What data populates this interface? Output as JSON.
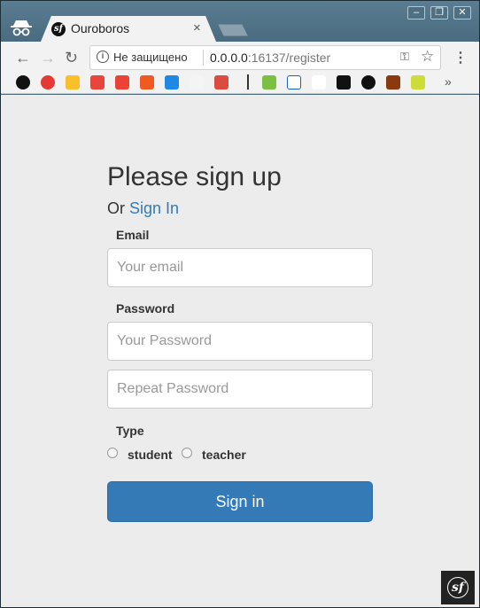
{
  "browser": {
    "tab_title": "Ouroboros",
    "tab_close": "×",
    "security_text": "Не защищено",
    "url_host": "0.0.0.0",
    "url_rest": ":16137/register",
    "window_controls": [
      "–",
      "❐",
      "✕"
    ],
    "bookmarks_more": "»"
  },
  "page": {
    "title": "Please sign up",
    "subtitle_prefix": "Or",
    "signin_link": "Sign In",
    "email_label": "Email",
    "email_placeholder": "Your email",
    "password_label": "Password",
    "password_placeholder": "Your Password",
    "repeat_placeholder": "Repeat Password",
    "type_label": "Type",
    "type_options": [
      "student",
      "teacher"
    ],
    "submit_label": "Sign in"
  }
}
